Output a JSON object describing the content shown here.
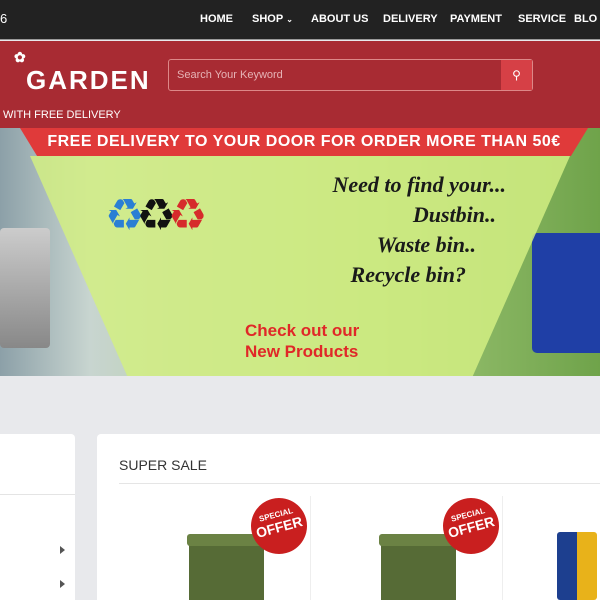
{
  "topbar": {
    "left_text": "6",
    "nav": [
      "HOME",
      "SHOP",
      "ABOUT US",
      "DELIVERY",
      "PAYMENT",
      "SERVICE",
      "BLO"
    ]
  },
  "header": {
    "logo": "GARDEN",
    "tagline": "WITH FREE DELIVERY",
    "search_placeholder": "Search Your Keyword",
    "search_icon": "search-icon"
  },
  "banner": {
    "ribbon": "FREE DELIVERY TO YOUR DOOR FOR ORDER MORE THAN 50€",
    "lines": [
      "Need to find your...",
      "Dustbin..",
      "Waste bin..",
      "Recycle bin?"
    ],
    "cta": [
      "Check out our",
      "New Products"
    ]
  },
  "sale": {
    "title": "SUPER SALE",
    "sticker_top": "SPECIAL",
    "sticker_main": "OFFER"
  },
  "colors": {
    "header": "#a82b33",
    "topbar": "#222222",
    "ribbon": "#e03a3a",
    "search_button": "#d64046"
  }
}
